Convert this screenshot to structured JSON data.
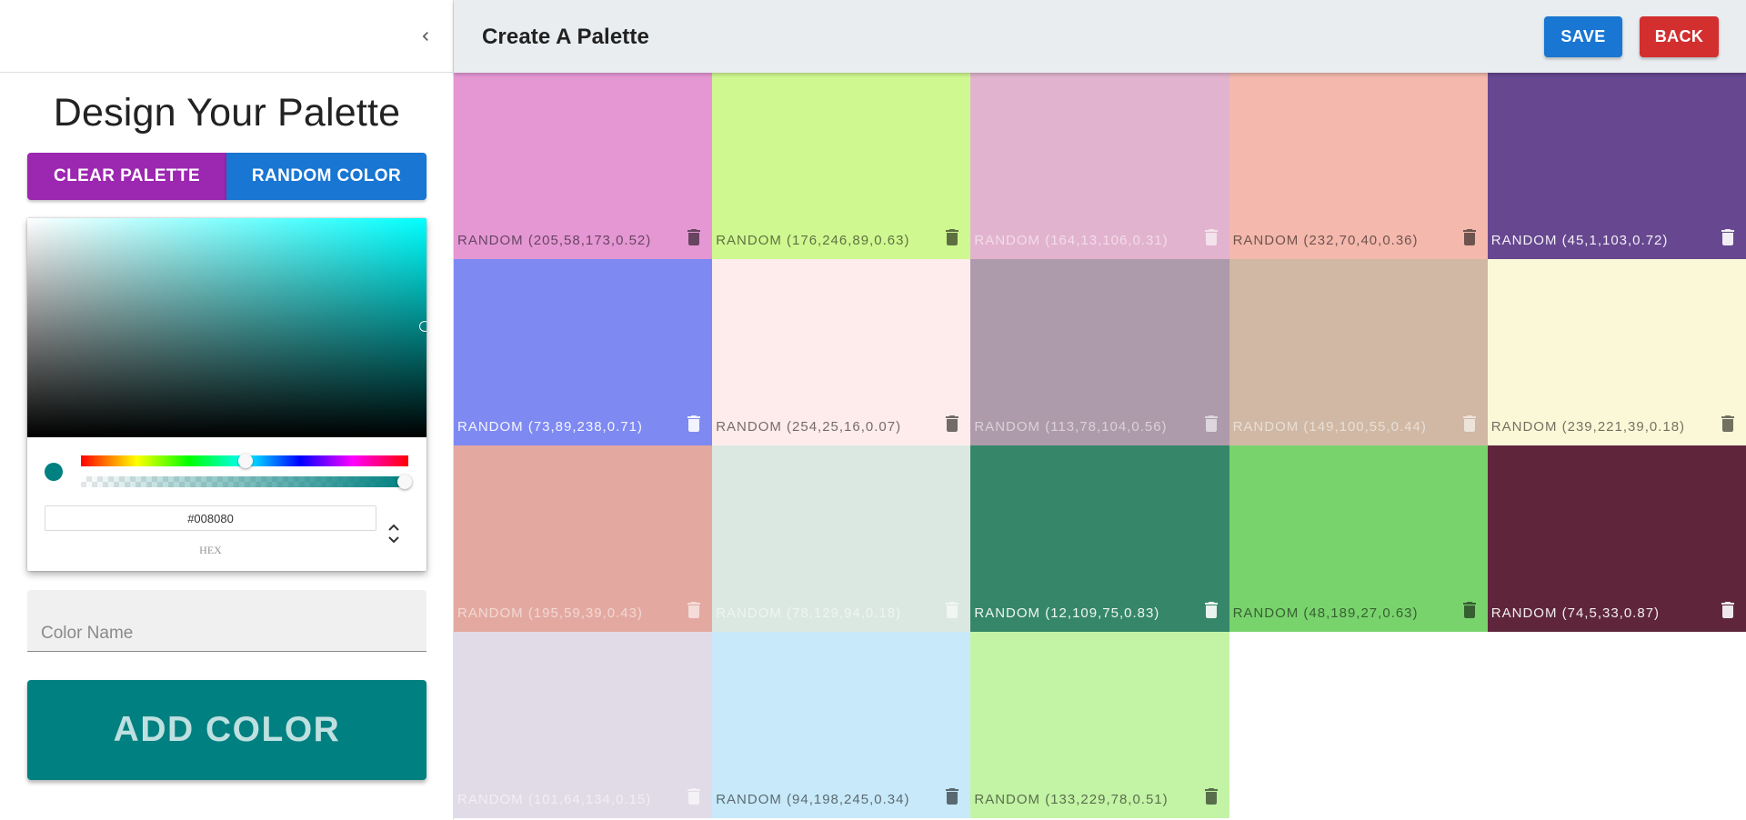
{
  "drawer": {
    "title": "Design Your Palette",
    "clear_label": "CLEAR PALETTE",
    "random_label": "RANDOM COLOR",
    "picker": {
      "current_color": "#008080",
      "hex_value": "#008080",
      "mode_label": "HEX"
    },
    "color_name_placeholder": "Color Name",
    "add_label": "ADD COLOR"
  },
  "appbar": {
    "title": "Create A Palette",
    "save_label": "SAVE",
    "back_label": "BACK",
    "save_color": "#1976d2",
    "back_color": "#d32f2f"
  },
  "palette": [
    {
      "name": "RANDOM (205,58,173,0.52)",
      "color": "#e597d4",
      "tone": "light"
    },
    {
      "name": "RANDOM (176,246,89,0.63)",
      "color": "#cff890",
      "tone": "light"
    },
    {
      "name": "RANDOM (164,13,106,0.31)",
      "color": "#e2b3cf",
      "tone": "faint"
    },
    {
      "name": "RANDOM (232,70,40,0.36)",
      "color": "#f4b8ad",
      "tone": "light"
    },
    {
      "name": "RANDOM (45,1,103,0.72)",
      "color": "#674790",
      "tone": "dark"
    },
    {
      "name": "RANDOM (73,89,238,0.71)",
      "color": "#7e89f2",
      "tone": "dark"
    },
    {
      "name": "RANDOM (254,25,16,0.07)",
      "color": "#feecec",
      "tone": "light"
    },
    {
      "name": "RANDOM (113,78,104,0.56)",
      "color": "#ad9aaa",
      "tone": "faint"
    },
    {
      "name": "RANDOM (149,100,55,0.44)",
      "color": "#d0b8a4",
      "tone": "faint"
    },
    {
      "name": "RANDOM (239,221,39,0.18)",
      "color": "#fbf8d8",
      "tone": "light"
    },
    {
      "name": "RANDOM (195,59,39,0.43)",
      "color": "#e3a9a0",
      "tone": "faint"
    },
    {
      "name": "RANDOM (78,129,94,0.18)",
      "color": "#dbe8e1",
      "tone": "faint"
    },
    {
      "name": "RANDOM (12,109,75,0.83)",
      "color": "#368769",
      "tone": "dark"
    },
    {
      "name": "RANDOM (48,189,27,0.63)",
      "color": "#79d36d",
      "tone": "light"
    },
    {
      "name": "RANDOM (74,5,33,0.87)",
      "color": "#5f263b",
      "tone": "dark"
    },
    {
      "name": "RANDOM (101,64,134,0.15)",
      "color": "#e0dbe6",
      "tone": "faint"
    },
    {
      "name": "RANDOM (94,198,245,0.34)",
      "color": "#c7e9f9",
      "tone": "light"
    },
    {
      "name": "RANDOM (133,229,78,0.51)",
      "color": "#c3f3a5",
      "tone": "light"
    }
  ]
}
